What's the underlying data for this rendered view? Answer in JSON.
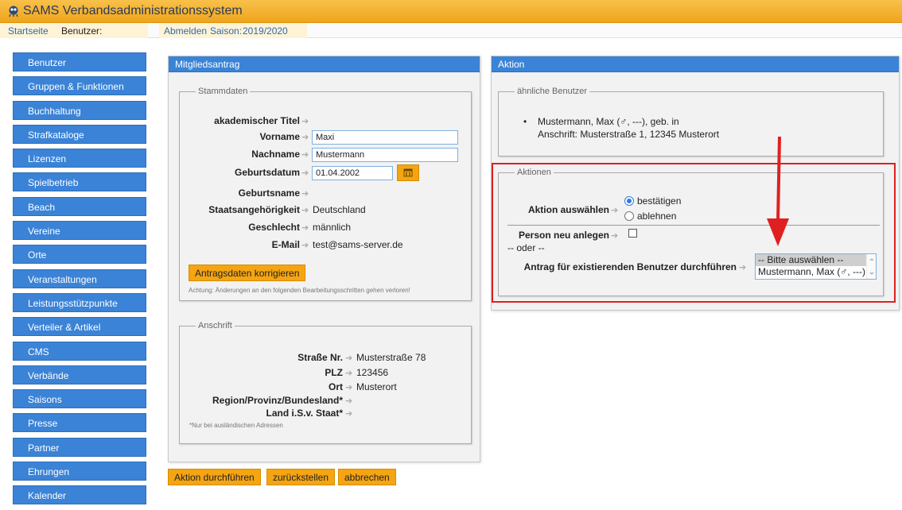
{
  "app": {
    "title": "SAMS Verbandsadministrationssystem"
  },
  "topnav": {
    "startseite": "Startseite",
    "benutzer_label": "Benutzer:",
    "abmelden": "Abmelden",
    "saison_label": "Saison:",
    "saison_value": "2019/2020"
  },
  "sidebar": {
    "items": [
      {
        "label": "Benutzer"
      },
      {
        "label": "Gruppen & Funktionen"
      },
      {
        "label": "Buchhaltung"
      },
      {
        "label": "Strafkataloge"
      },
      {
        "label": "Lizenzen"
      },
      {
        "label": "Spielbetrieb"
      },
      {
        "label": "Beach"
      },
      {
        "label": "Vereine"
      },
      {
        "label": "Orte"
      },
      {
        "label": "Veranstaltungen"
      },
      {
        "label": "Leistungsstützpunkte"
      },
      {
        "label": "Verteiler & Artikel"
      },
      {
        "label": "CMS"
      },
      {
        "label": "Verbände"
      },
      {
        "label": "Saisons"
      },
      {
        "label": "Presse"
      },
      {
        "label": "Partner"
      },
      {
        "label": "Ehrungen"
      },
      {
        "label": "Kalender"
      }
    ]
  },
  "mitglied": {
    "header": "Mitgliedsantrag",
    "stammdaten": {
      "legend": "Stammdaten",
      "titel_label": "akademischer Titel",
      "vorname_label": "Vorname",
      "vorname_value": "Maxi",
      "nachname_label": "Nachname",
      "nachname_value": "Mustermann",
      "geburtsdatum_label": "Geburtsdatum",
      "geburtsdatum_value": "01.04.2002",
      "geburtsname_label": "Geburtsname",
      "staat_label": "Staatsangehörigkeit",
      "staat_value": "Deutschland",
      "geschlecht_label": "Geschlecht",
      "geschlecht_value": "männlich",
      "email_label": "E-Mail",
      "email_value": "test@sams-server.de",
      "korrigieren_button": "Antragsdaten korrigieren",
      "warning": "Achtung: Änderungen an den folgenden Bearbeitungsschritten gehen verloren!"
    },
    "anschrift": {
      "legend": "Anschrift",
      "strasse_label": "Straße Nr.",
      "strasse_value": "Musterstraße 78",
      "plz_label": "PLZ",
      "plz_value": "123456",
      "ort_label": "Ort",
      "ort_value": "Musterort",
      "region_label": "Region/Provinz/Bundesland*",
      "land_label": "Land i.S.v. Staat*",
      "note": "*Nur bei ausländischen Adressen"
    }
  },
  "aktion": {
    "header": "Aktion",
    "aehnliche": {
      "legend": "ähnliche Benutzer",
      "line1": "Mustermann, Max (♂, ---), geb. in",
      "line2": "Anschrift: Musterstraße 1, 12345 Musterort"
    },
    "aktionen": {
      "legend": "Aktionen",
      "auswaehlen_label": "Aktion auswählen",
      "opt_bestaetigen": "bestätigen",
      "opt_ablehnen": "ablehnen",
      "neu_label": "Person neu anlegen",
      "oder": "-- oder --",
      "existierend_label": "Antrag für existierenden Benutzer durchführen",
      "list_options": [
        "-- Bitte auswählen --",
        "Mustermann, Max (♂, ---)"
      ]
    }
  },
  "buttons": {
    "durchfuehren": "Aktion durchführen",
    "zurueckstellen": "zurückstellen",
    "abbrechen": "abbrechen"
  },
  "colors": {
    "accent_blue": "#3b83d6",
    "orange": "#f5a512",
    "highlight_red": "#e02020"
  }
}
